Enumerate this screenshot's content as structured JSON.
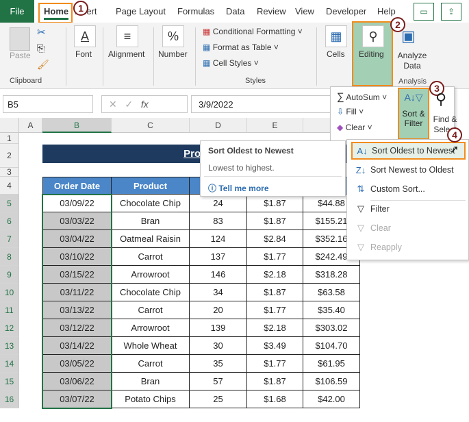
{
  "tabs": {
    "file": "File",
    "home": "Home",
    "insert": "Insert",
    "page_layout": "Page Layout",
    "formulas": "Formulas",
    "data": "Data",
    "review": "Review",
    "view": "View",
    "developer": "Developer",
    "help": "Help"
  },
  "ribbon": {
    "paste": "Paste",
    "clipboard": "Clipboard",
    "font": "Font",
    "alignment": "Alignment",
    "number": "Number",
    "conditional_formatting": "Conditional Formatting",
    "format_as_table": "Format as Table",
    "cell_styles": "Cell Styles",
    "styles": "Styles",
    "cells": "Cells",
    "editing": "Editing",
    "analyze_data": "Analyze Data",
    "analysis": "Analysis"
  },
  "editing_menu": {
    "autosum": "AutoSum",
    "fill": "Fill",
    "clear": "Clear",
    "sort_filter": "Sort & Filter",
    "find_select": "Find & Select"
  },
  "formula_bar": {
    "name_box": "B5",
    "fx": "fx",
    "value": "3/9/2022"
  },
  "columns": [
    "A",
    "B",
    "C",
    "D",
    "E"
  ],
  "rows": [
    "1",
    "2",
    "3",
    "4",
    "5",
    "6",
    "7",
    "8",
    "9",
    "10",
    "11",
    "12",
    "13",
    "14",
    "15",
    "16"
  ],
  "table": {
    "title": "Produc",
    "headers": [
      "Order Date",
      "Product"
    ],
    "data": [
      [
        "03/09/22",
        "Chocolate Chip",
        "24",
        "$1.87",
        "$44.88"
      ],
      [
        "03/03/22",
        "Bran",
        "83",
        "$1.87",
        "$155.21"
      ],
      [
        "03/04/22",
        "Oatmeal Raisin",
        "124",
        "$2.84",
        "$352.16"
      ],
      [
        "03/10/22",
        "Carrot",
        "137",
        "$1.77",
        "$242.49"
      ],
      [
        "03/15/22",
        "Arrowroot",
        "146",
        "$2.18",
        "$318.28"
      ],
      [
        "03/11/22",
        "Chocolate Chip",
        "34",
        "$1.87",
        "$63.58"
      ],
      [
        "03/13/22",
        "Carrot",
        "20",
        "$1.77",
        "$35.40"
      ],
      [
        "03/12/22",
        "Arrowroot",
        "139",
        "$2.18",
        "$303.02"
      ],
      [
        "03/14/22",
        "Whole Wheat",
        "30",
        "$3.49",
        "$104.70"
      ],
      [
        "03/05/22",
        "Carrot",
        "35",
        "$1.77",
        "$61.95"
      ],
      [
        "03/06/22",
        "Bran",
        "57",
        "$1.87",
        "$106.59"
      ],
      [
        "03/07/22",
        "Potato Chips",
        "25",
        "$1.68",
        "$42.00"
      ]
    ]
  },
  "tooltip": {
    "title": "Sort Oldest to Newest",
    "desc": "Lowest to highest.",
    "link": "Tell me more"
  },
  "sort_menu": {
    "items": [
      "Sort Oldest to Newest",
      "Sort Newest to Oldest",
      "Custom Sort...",
      "Filter",
      "Clear",
      "Reapply"
    ]
  },
  "steps": [
    "1",
    "2",
    "3",
    "4"
  ]
}
